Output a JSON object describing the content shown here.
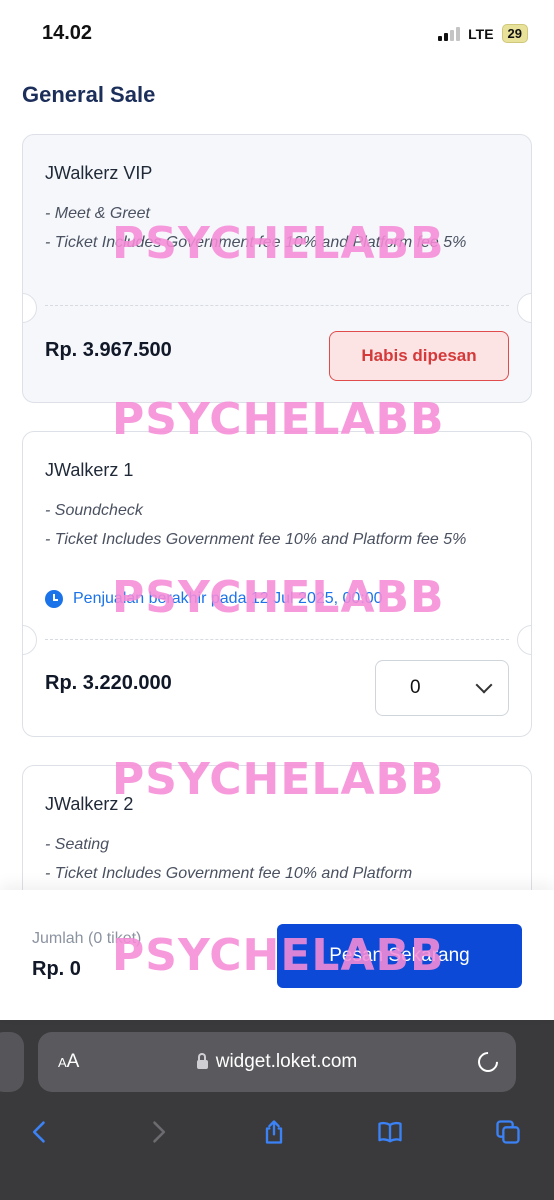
{
  "status_bar": {
    "time": "14.02",
    "network": "LTE",
    "battery": "29"
  },
  "section_title": "General Sale",
  "tickets": [
    {
      "name": "JWalkerz VIP",
      "desc": [
        "- Meet & Greet",
        "- Ticket Includes Government fee 10% and Platform fee 5%"
      ],
      "price": "Rp. 3.967.500",
      "status_label": "Habis dipesan"
    },
    {
      "name": "JWalkerz 1",
      "desc": [
        "- Soundcheck",
        "- Ticket Includes Government fee 10% and Platform fee 5%"
      ],
      "sale_end": "Penjualan berakhir pada 12 Jul 2025, 00:00",
      "price": "Rp. 3.220.000",
      "qty": "0"
    },
    {
      "name": "JWalkerz 2",
      "desc": [
        "- Seating",
        "- Ticket Includes Government fee 10% and Platform"
      ]
    }
  ],
  "footer": {
    "label": "Jumlah (0 tiket)",
    "total": "Rp. 0",
    "order_button": "Pesan Sekarang"
  },
  "watermark": "PSYCHELABB",
  "browser": {
    "aa_label": "AA",
    "url": "widget.loket.com"
  },
  "colors": {
    "primary": "#0b49d6",
    "title": "#1c2f5a",
    "soldout": "#d43a3a",
    "link": "#1a73e8",
    "watermark": "#f68cd7"
  },
  "icons": [
    "lock-icon",
    "reload-icon",
    "back-icon",
    "forward-icon",
    "share-icon",
    "bookmarks-icon",
    "tabs-icon",
    "clock-icon",
    "chevron-down-icon"
  ]
}
